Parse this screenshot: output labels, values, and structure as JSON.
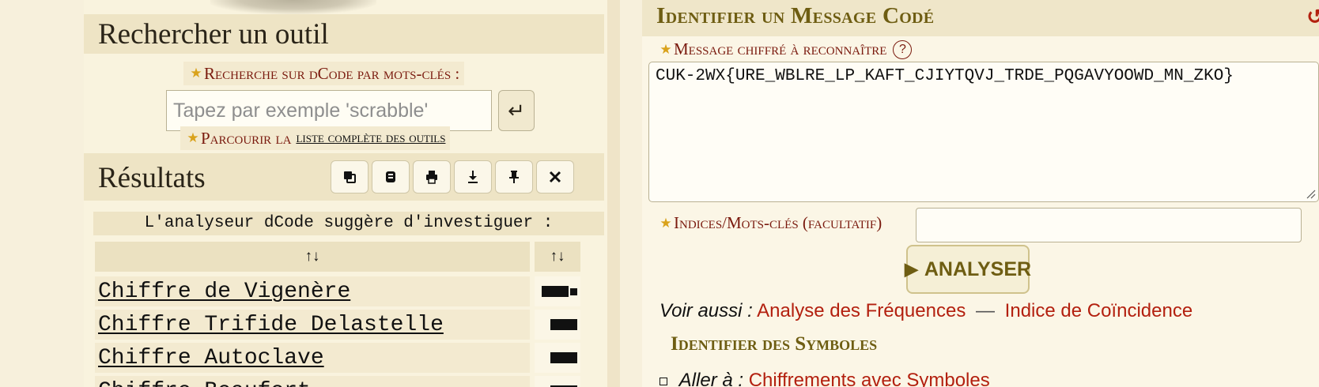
{
  "left": {
    "search_section_title": "Rechercher un outil",
    "keywords_label": "Recherche sur dCode par mots-clés :",
    "search_placeholder": "Tapez par exemple 'scrabble'",
    "browse_prefix": "Parcourir la",
    "browse_link": "liste complète des outils",
    "results_title": "Résultats",
    "toolbar_icons": [
      "copy-icon",
      "scroll-icon",
      "print-icon",
      "download-icon",
      "pin-icon",
      "close-icon"
    ],
    "suggest_text": "L'analyseur dCode suggère d'investiguer :",
    "table": {
      "headers": [
        "↑↓",
        "↑↓"
      ],
      "rows": [
        {
          "name": "Chiffre de Vigenère",
          "score_level": "high"
        },
        {
          "name": "Chiffre Trifide Delastelle",
          "score_level": "medium"
        },
        {
          "name": "Chiffre Autoclave",
          "score_level": "medium"
        },
        {
          "name": "Chiffre Beaufort",
          "score_level": "medium"
        }
      ]
    }
  },
  "right": {
    "title": "Identifier un Message Codé",
    "cipher_label": "Message chiffré à reconnaître",
    "help_symbol": "?",
    "cipher_value": "CUK-2WX{URE_WBLRE_LP_KAFT_CJIYTQVJ_TRDE_PQGAVYOOWD_MN_ZKO}",
    "hints_label": "Indices/Mots-clés (facultatif)",
    "hints_value": "",
    "analyze_label": "ANALYSER",
    "see_also_label": "Voir aussi :",
    "see_also_links": [
      "Analyse des Fréquences",
      "Indice de Coïncidence"
    ],
    "see_also_separator": "—",
    "identify_symbols": "Identifier des Symboles",
    "goto_label": "Aller à :",
    "goto_link": "Chiffrements avec Symboles"
  },
  "colors": {
    "accent_red": "#b3200f",
    "heading_olive": "#6e5d12",
    "star_gold": "#d9a21b",
    "panel_beige": "#eee4c5"
  }
}
